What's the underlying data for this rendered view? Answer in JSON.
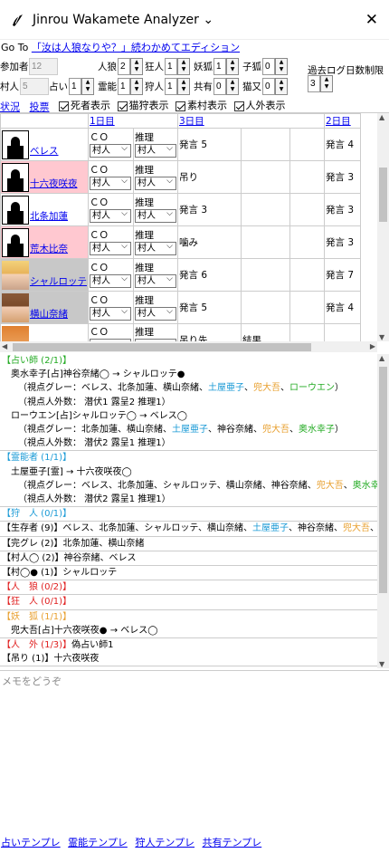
{
  "app": {
    "title": "Jinrou Wakamete Analyzer",
    "chevron": "⌄",
    "close": "✕"
  },
  "goto": {
    "label": "Go To",
    "link": "「汝は人狼なりや？」続わかめてエディション"
  },
  "config": {
    "participants_label": "参加者",
    "participants": "12",
    "villagers_label": "村人",
    "villagers": "5",
    "wolf_label": "人狼",
    "wolf": "2",
    "fortune_label": "占い",
    "fortune": "1",
    "madman_label": "狂人",
    "madman": "1",
    "medium_label": "霊能",
    "medium": "1",
    "fox_label": "妖狐",
    "fox": "1",
    "hunter_label": "狩人",
    "hunter": "1",
    "child_fox_label": "子狐",
    "child_fox": "0",
    "shared_label": "共有",
    "shared": "0",
    "cat_label": "猫又",
    "cat": "0",
    "log_label": "過去ログ日数制限",
    "log_days": "3"
  },
  "links": {
    "status": "状況",
    "vote": "投票"
  },
  "checkboxes": [
    {
      "label": "死者表示",
      "checked": true
    },
    {
      "label": "猫狩表示",
      "checked": true
    },
    {
      "label": "素村表示",
      "checked": true
    },
    {
      "label": "人外表示",
      "checked": true
    }
  ],
  "days": [
    "1日目",
    "3日目",
    "2日目"
  ],
  "players": [
    {
      "name": "ベレス",
      "avatar": "black",
      "bg": "white",
      "co": "ＣＯ",
      "infer": "推理",
      "sel1": "村人",
      "sel2": "村人",
      "d1": "発言 5",
      "d3": "",
      "d2": "発言 4"
    },
    {
      "name": "十六夜咲夜",
      "avatar": "black",
      "bg": "pink",
      "co": "ＣＯ",
      "infer": "推理",
      "sel1": "村人",
      "sel2": "村人",
      "d1": "吊り",
      "d3": "",
      "d2": "発言 3"
    },
    {
      "name": "北条加蓮",
      "avatar": "black",
      "bg": "white",
      "co": "ＣＯ",
      "infer": "推理",
      "sel1": "村人",
      "sel2": "村人",
      "d1": "発言 3",
      "d3": "",
      "d2": "発言 3"
    },
    {
      "name": "荒木比奈",
      "avatar": "black",
      "bg": "pink",
      "co": "ＣＯ",
      "infer": "推理",
      "sel1": "村人",
      "sel2": "村人",
      "d1": "噛み",
      "d3": "",
      "d2": "発言 3"
    },
    {
      "name": "シャルロッテ",
      "avatar": "blonde",
      "bg": "gray",
      "co": "ＣＯ",
      "infer": "推理",
      "sel1": "村人",
      "sel2": "村人",
      "d1": "発言 6",
      "d3": "",
      "d2": "発言 7"
    },
    {
      "name": "横山奈緒",
      "avatar": "brown",
      "bg": "gray",
      "co": "ＣＯ",
      "infer": "推理",
      "sel1": "村人",
      "sel2": "村人",
      "d1": "発言 5",
      "d3": "",
      "d2": "発言 4"
    },
    {
      "name": "",
      "avatar": "orange",
      "bg": "white",
      "co": "ＣＯ",
      "infer": "推理",
      "sel1": "",
      "sel2": "",
      "d1": "吊り先",
      "d3": "結果",
      "d2": ""
    }
  ],
  "summary": [
    {
      "color": "#22aa22",
      "lines": [
        {
          "t": "【占い師 (2/1)】",
          "c": "#22aa22",
          "i": 0
        },
        {
          "t": "奥水幸子[占]神谷奈緒◯ → シャルロッテ●",
          "i": 1
        },
        {
          "t": "（視点グレー：ベレス、北条加蓮、横山奈緒、土屋亜子、兜大吾、ローウエン）",
          "i": 2,
          "parts": [
            [
              "（視点グレー：ベレス、北条加蓮、横山奈緒、",
              ""
            ],
            [
              "土屋亜子",
              "#1a9ad6"
            ],
            [
              "、",
              ""
            ],
            [
              "兜大吾",
              "#e8a030"
            ],
            [
              "、",
              ""
            ],
            [
              "ローウエン",
              "#22aa22"
            ],
            [
              "）",
              ""
            ]
          ]
        },
        {
          "t": "（視点人外数： 潜伏1 露呈2 推理1）",
          "i": 2
        },
        {
          "t": "ローウエン[占]シャルロッテ◯ → ベレス◯",
          "i": 1
        },
        {
          "t": "（視点グレー：北条加蓮、横山奈緒、土屋亜子、神谷奈緒、兜大吾、奥水幸子）",
          "i": 2,
          "parts": [
            [
              "（視点グレー：北条加蓮、横山奈緒、",
              ""
            ],
            [
              "土屋亜子",
              "#1a9ad6"
            ],
            [
              "、神谷奈緒、",
              ""
            ],
            [
              "兜大吾",
              "#e8a030"
            ],
            [
              "、",
              ""
            ],
            [
              "奥水幸子",
              "#22aa22"
            ],
            [
              "）",
              ""
            ]
          ]
        },
        {
          "t": "（視点人外数： 潜伏2 露呈1 推理1）",
          "i": 2
        }
      ]
    },
    {
      "lines": [
        {
          "t": "【霊能者 (1/1)】",
          "c": "#1a9ad6",
          "i": 0
        },
        {
          "t": "土屋亜子[霊] → 十六夜咲夜◯",
          "i": 1
        },
        {
          "t": "（視点グレー：ベレス、北条加蓮、シャルロッテ、横山奈緒、神谷奈緒、兜大吾、奥水幸子、ロー",
          "i": 2,
          "parts": [
            [
              "（視点グレー：ベレス、北条加蓮、シャルロッテ、横山奈緒、神谷奈緒、",
              ""
            ],
            [
              "兜大吾",
              "#e8a030"
            ],
            [
              "、",
              ""
            ],
            [
              "奥水幸子",
              "#22aa22"
            ],
            [
              "、",
              ""
            ],
            [
              "ロー",
              "#22aa22"
            ]
          ]
        },
        {
          "t": "（視点人外数： 潜伏2 露呈1 推理1）",
          "i": 2
        }
      ]
    },
    {
      "lines": [
        {
          "t": "【狩　人 (0/1)】",
          "c": "#1a9ad6",
          "i": 0
        }
      ]
    },
    {
      "lines": [
        {
          "t": "【生存者 (9)】ベレス、北条加蓮、シャルロッテ、横山奈緒、土屋亜子、神谷奈緒、兜大吾、奥水幸",
          "i": 0,
          "parts": [
            [
              "【生存者 (9)】ベレス、北条加蓮、シャルロッテ、横山奈緒、",
              ""
            ],
            [
              "土屋亜子",
              "#1a9ad6"
            ],
            [
              "、神谷奈緒、",
              ""
            ],
            [
              "兜大吾",
              "#e8a030"
            ],
            [
              "、",
              ""
            ],
            [
              "奥水幸",
              "#22aa22"
            ]
          ]
        }
      ]
    },
    {
      "lines": [
        {
          "t": "【完グレ (2)】北条加蓮、横山奈緒",
          "i": 0
        }
      ]
    },
    {
      "lines": [
        {
          "t": "【村人◯ (2)】神谷奈緒、ベレス",
          "i": 0
        }
      ]
    },
    {
      "lines": [
        {
          "t": "【村◯● (1)】シャルロッテ",
          "i": 0
        }
      ]
    },
    {
      "lines": [
        {
          "t": "【人　狼 (0/2)】",
          "c": "#e02020",
          "i": 0
        }
      ]
    },
    {
      "lines": [
        {
          "t": "【狂　人 (0/1)】",
          "c": "#e02020",
          "i": 0
        }
      ]
    },
    {
      "lines": [
        {
          "t": "【妖　狐 (1/1)】",
          "c": "#e8a030",
          "i": 0
        },
        {
          "t": "兜大吾[占]十六夜咲夜● → ベレス◯",
          "i": 1
        }
      ]
    },
    {
      "lines": [
        {
          "t": "【人　外 (1/3)】偽占い師1",
          "i": 0,
          "parts": [
            [
              "【人　外 (1/3)】",
              "#e02020"
            ],
            [
              "偽占い師1",
              ""
            ]
          ]
        },
        {
          "t": "【吊り (1)】十六夜咲夜",
          "i": 0
        }
      ]
    }
  ],
  "memo": {
    "placeholder": "メモをどうぞ"
  },
  "footer": [
    "占いテンプレ",
    "霊能テンプレ",
    "狩人テンプレ",
    "共有テンプレ"
  ]
}
